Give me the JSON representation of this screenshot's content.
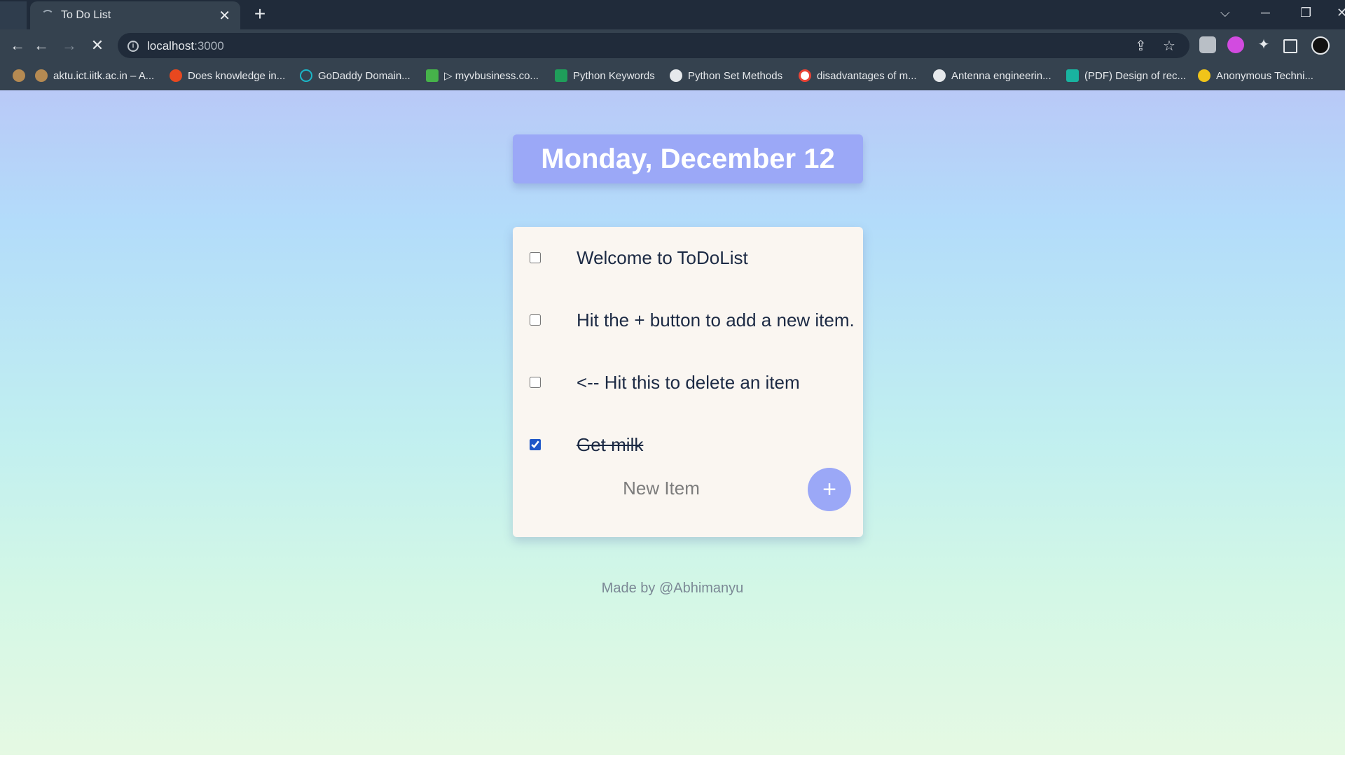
{
  "browser": {
    "tab_title": "To Do List",
    "tab_close": "✕",
    "new_tab": "+",
    "url_host": "localhost",
    "url_port": ":3000",
    "bookmarks": [
      {
        "label": "aktu.ict.iitk.ac.in – A...",
        "color": "#b58a52"
      },
      {
        "label": "Does knowledge in...",
        "color": "#e8481f"
      },
      {
        "label": "GoDaddy Domain...",
        "color": "#1bb7c8"
      },
      {
        "label": "▷ myvbusiness.co...",
        "color": "#46b34a"
      },
      {
        "label": "Python Keywords",
        "color": "#1f9e5a"
      },
      {
        "label": "Python Set Methods",
        "color": "#e6e9ec"
      },
      {
        "label": "disadvantages of m...",
        "color": "#ffffff"
      },
      {
        "label": "Antenna engineerin...",
        "color": "#e6e9ec"
      },
      {
        "label": "(PDF) Design of rec...",
        "color": "#19b3a0"
      },
      {
        "label": "Anonymous Techni...",
        "color": "#f0c419"
      }
    ]
  },
  "page": {
    "date_heading": "Monday, December 12",
    "items": [
      {
        "text": "Welcome to ToDoList",
        "checked": false
      },
      {
        "text": "Hit the + button to add a new item.",
        "checked": false
      },
      {
        "text": "<-- Hit this to delete an item",
        "checked": false
      },
      {
        "text": "Get milk",
        "checked": true
      }
    ],
    "new_item_placeholder": "New Item",
    "add_button_label": "+",
    "footer": "Made by @Abhimanyu"
  },
  "colors": {
    "accent": "#9ba8f7",
    "card": "#faf6f1",
    "text": "#1c2a44"
  }
}
